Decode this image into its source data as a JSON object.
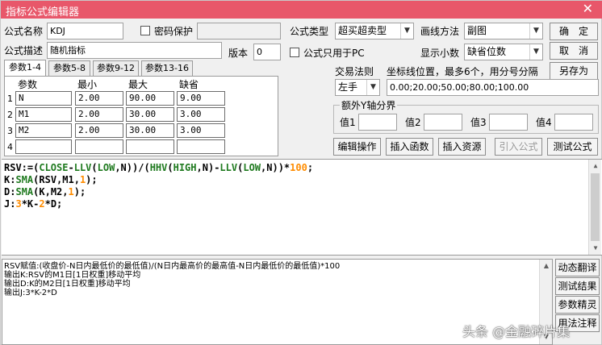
{
  "window": {
    "title": "指标公式编辑器",
    "close_glyph": "✕"
  },
  "form": {
    "name_label": "公式名称",
    "name_value": "KDJ",
    "password_label": "密码保护",
    "password_value": "",
    "desc_label": "公式描述",
    "desc_value": "随机指标",
    "version_label": "版本",
    "version_value": "0",
    "pc_only_label": "公式只用于PC",
    "type_label": "公式类型",
    "type_value": "超买超卖型",
    "draw_label": "画线方法",
    "draw_value": "副图",
    "decimals_label": "显示小数",
    "decimals_value": "缺省位数",
    "trade_rule_label": "交易法则",
    "trade_rule_value": "左手",
    "coord_label": "坐标线位置，最多6个，用分号分隔",
    "coord_value": "0.00;20.00;50.00;80.00;100.00",
    "extra_y_label": "额外Y轴分界",
    "v1_label": "值1",
    "v2_label": "值2",
    "v3_label": "值3",
    "v4_label": "值4"
  },
  "buttons": {
    "ok": "确　定",
    "cancel": "取　消",
    "save_as": "另存为",
    "edit_op": "编辑操作",
    "insert_func": "插入函数",
    "insert_res": "插入资源",
    "import_formula": "引入公式",
    "test_formula": "测试公式"
  },
  "tabs": [
    "参数1-4",
    "参数5-8",
    "参数9-12",
    "参数13-16"
  ],
  "params": {
    "headers": [
      "参数",
      "最小",
      "最大",
      "缺省"
    ],
    "rows": [
      {
        "idx": "1",
        "name": "N",
        "min": "2.00",
        "max": "90.00",
        "def": "9.00"
      },
      {
        "idx": "2",
        "name": "M1",
        "min": "2.00",
        "max": "30.00",
        "def": "3.00"
      },
      {
        "idx": "3",
        "name": "M2",
        "min": "2.00",
        "max": "30.00",
        "def": "3.00"
      },
      {
        "idx": "4",
        "name": "",
        "min": "",
        "max": "",
        "def": ""
      }
    ]
  },
  "editor": {
    "colors": {
      "plain": "#000000",
      "func": "#1f7a1f",
      "var": "#2020c0",
      "num": "#ff8c00",
      "sym": "#7a0000"
    },
    "lines": [
      [
        {
          "t": "RSV:=(",
          "c": "plain"
        },
        {
          "t": "CLOSE",
          "c": "func"
        },
        {
          "t": "-",
          "c": "plain"
        },
        {
          "t": "LLV",
          "c": "func"
        },
        {
          "t": "(",
          "c": "plain"
        },
        {
          "t": "LOW",
          "c": "func"
        },
        {
          "t": ",N))/(",
          "c": "plain"
        },
        {
          "t": "HHV",
          "c": "func"
        },
        {
          "t": "(",
          "c": "plain"
        },
        {
          "t": "HIGH",
          "c": "func"
        },
        {
          "t": ",N)-",
          "c": "plain"
        },
        {
          "t": "LLV",
          "c": "func"
        },
        {
          "t": "(",
          "c": "plain"
        },
        {
          "t": "LOW",
          "c": "func"
        },
        {
          "t": ",N))*",
          "c": "plain"
        },
        {
          "t": "100",
          "c": "num"
        },
        {
          "t": ";",
          "c": "plain"
        }
      ],
      [
        {
          "t": "K:",
          "c": "plain"
        },
        {
          "t": "SMA",
          "c": "func"
        },
        {
          "t": "(RSV,M1,",
          "c": "plain"
        },
        {
          "t": "1",
          "c": "num"
        },
        {
          "t": ");",
          "c": "plain"
        }
      ],
      [
        {
          "t": "D:",
          "c": "plain"
        },
        {
          "t": "SMA",
          "c": "func"
        },
        {
          "t": "(K,M2,",
          "c": "plain"
        },
        {
          "t": "1",
          "c": "num"
        },
        {
          "t": ");",
          "c": "plain"
        }
      ],
      [
        {
          "t": "J:",
          "c": "plain"
        },
        {
          "t": "3",
          "c": "num"
        },
        {
          "t": "*K-",
          "c": "plain"
        },
        {
          "t": "2",
          "c": "num"
        },
        {
          "t": "*D;",
          "c": "plain"
        }
      ]
    ]
  },
  "output": {
    "lines": [
      "RSV赋值:(收盘价-N日内最低价的最低值)/(N日内最高价的最高值-N日内最低价的最低值)*100",
      "输出K:RSV的M1日[1日权重]移动平均",
      "输出D:K的M2日[1日权重]移动平均",
      "输出J:3*K-2*D"
    ]
  },
  "side_buttons": [
    "动态翻译",
    "测试结果",
    "参数精灵",
    "用法注释"
  ],
  "watermark": "头条 @金融碎片集"
}
